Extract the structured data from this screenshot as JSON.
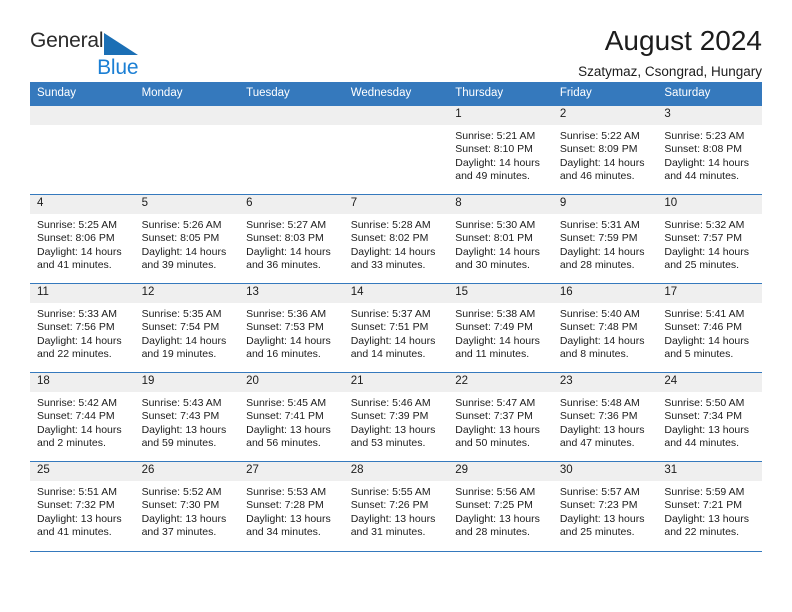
{
  "brand": {
    "name_top": "General",
    "name_bottom": "Blue",
    "triangle_icon": "blue-triangle-icon",
    "color_top": "#2b2b2b",
    "color_bottom": "#1b7fd4"
  },
  "header": {
    "title": "August 2024",
    "subtitle": "Szatymaz, Csongrad, Hungary"
  },
  "theme": {
    "header_blue": "#3579bd",
    "daynum_band": "#efefef",
    "text": "#1c1c1c"
  },
  "weekdays": [
    "Sunday",
    "Monday",
    "Tuesday",
    "Wednesday",
    "Thursday",
    "Friday",
    "Saturday"
  ],
  "weeks": [
    [
      {
        "day": "",
        "sunrise": "",
        "sunset": "",
        "daylight_line1": "",
        "daylight_line2": "",
        "empty": true
      },
      {
        "day": "",
        "sunrise": "",
        "sunset": "",
        "daylight_line1": "",
        "daylight_line2": "",
        "empty": true
      },
      {
        "day": "",
        "sunrise": "",
        "sunset": "",
        "daylight_line1": "",
        "daylight_line2": "",
        "empty": true
      },
      {
        "day": "",
        "sunrise": "",
        "sunset": "",
        "daylight_line1": "",
        "daylight_line2": "",
        "empty": true
      },
      {
        "day": "1",
        "sunrise": "Sunrise: 5:21 AM",
        "sunset": "Sunset: 8:10 PM",
        "daylight_line1": "Daylight: 14 hours",
        "daylight_line2": "and 49 minutes.",
        "empty": false
      },
      {
        "day": "2",
        "sunrise": "Sunrise: 5:22 AM",
        "sunset": "Sunset: 8:09 PM",
        "daylight_line1": "Daylight: 14 hours",
        "daylight_line2": "and 46 minutes.",
        "empty": false
      },
      {
        "day": "3",
        "sunrise": "Sunrise: 5:23 AM",
        "sunset": "Sunset: 8:08 PM",
        "daylight_line1": "Daylight: 14 hours",
        "daylight_line2": "and 44 minutes.",
        "empty": false
      }
    ],
    [
      {
        "day": "4",
        "sunrise": "Sunrise: 5:25 AM",
        "sunset": "Sunset: 8:06 PM",
        "daylight_line1": "Daylight: 14 hours",
        "daylight_line2": "and 41 minutes.",
        "empty": false
      },
      {
        "day": "5",
        "sunrise": "Sunrise: 5:26 AM",
        "sunset": "Sunset: 8:05 PM",
        "daylight_line1": "Daylight: 14 hours",
        "daylight_line2": "and 39 minutes.",
        "empty": false
      },
      {
        "day": "6",
        "sunrise": "Sunrise: 5:27 AM",
        "sunset": "Sunset: 8:03 PM",
        "daylight_line1": "Daylight: 14 hours",
        "daylight_line2": "and 36 minutes.",
        "empty": false
      },
      {
        "day": "7",
        "sunrise": "Sunrise: 5:28 AM",
        "sunset": "Sunset: 8:02 PM",
        "daylight_line1": "Daylight: 14 hours",
        "daylight_line2": "and 33 minutes.",
        "empty": false
      },
      {
        "day": "8",
        "sunrise": "Sunrise: 5:30 AM",
        "sunset": "Sunset: 8:01 PM",
        "daylight_line1": "Daylight: 14 hours",
        "daylight_line2": "and 30 minutes.",
        "empty": false
      },
      {
        "day": "9",
        "sunrise": "Sunrise: 5:31 AM",
        "sunset": "Sunset: 7:59 PM",
        "daylight_line1": "Daylight: 14 hours",
        "daylight_line2": "and 28 minutes.",
        "empty": false
      },
      {
        "day": "10",
        "sunrise": "Sunrise: 5:32 AM",
        "sunset": "Sunset: 7:57 PM",
        "daylight_line1": "Daylight: 14 hours",
        "daylight_line2": "and 25 minutes.",
        "empty": false
      }
    ],
    [
      {
        "day": "11",
        "sunrise": "Sunrise: 5:33 AM",
        "sunset": "Sunset: 7:56 PM",
        "daylight_line1": "Daylight: 14 hours",
        "daylight_line2": "and 22 minutes.",
        "empty": false
      },
      {
        "day": "12",
        "sunrise": "Sunrise: 5:35 AM",
        "sunset": "Sunset: 7:54 PM",
        "daylight_line1": "Daylight: 14 hours",
        "daylight_line2": "and 19 minutes.",
        "empty": false
      },
      {
        "day": "13",
        "sunrise": "Sunrise: 5:36 AM",
        "sunset": "Sunset: 7:53 PM",
        "daylight_line1": "Daylight: 14 hours",
        "daylight_line2": "and 16 minutes.",
        "empty": false
      },
      {
        "day": "14",
        "sunrise": "Sunrise: 5:37 AM",
        "sunset": "Sunset: 7:51 PM",
        "daylight_line1": "Daylight: 14 hours",
        "daylight_line2": "and 14 minutes.",
        "empty": false
      },
      {
        "day": "15",
        "sunrise": "Sunrise: 5:38 AM",
        "sunset": "Sunset: 7:49 PM",
        "daylight_line1": "Daylight: 14 hours",
        "daylight_line2": "and 11 minutes.",
        "empty": false
      },
      {
        "day": "16",
        "sunrise": "Sunrise: 5:40 AM",
        "sunset": "Sunset: 7:48 PM",
        "daylight_line1": "Daylight: 14 hours",
        "daylight_line2": "and 8 minutes.",
        "empty": false
      },
      {
        "day": "17",
        "sunrise": "Sunrise: 5:41 AM",
        "sunset": "Sunset: 7:46 PM",
        "daylight_line1": "Daylight: 14 hours",
        "daylight_line2": "and 5 minutes.",
        "empty": false
      }
    ],
    [
      {
        "day": "18",
        "sunrise": "Sunrise: 5:42 AM",
        "sunset": "Sunset: 7:44 PM",
        "daylight_line1": "Daylight: 14 hours",
        "daylight_line2": "and 2 minutes.",
        "empty": false
      },
      {
        "day": "19",
        "sunrise": "Sunrise: 5:43 AM",
        "sunset": "Sunset: 7:43 PM",
        "daylight_line1": "Daylight: 13 hours",
        "daylight_line2": "and 59 minutes.",
        "empty": false
      },
      {
        "day": "20",
        "sunrise": "Sunrise: 5:45 AM",
        "sunset": "Sunset: 7:41 PM",
        "daylight_line1": "Daylight: 13 hours",
        "daylight_line2": "and 56 minutes.",
        "empty": false
      },
      {
        "day": "21",
        "sunrise": "Sunrise: 5:46 AM",
        "sunset": "Sunset: 7:39 PM",
        "daylight_line1": "Daylight: 13 hours",
        "daylight_line2": "and 53 minutes.",
        "empty": false
      },
      {
        "day": "22",
        "sunrise": "Sunrise: 5:47 AM",
        "sunset": "Sunset: 7:37 PM",
        "daylight_line1": "Daylight: 13 hours",
        "daylight_line2": "and 50 minutes.",
        "empty": false
      },
      {
        "day": "23",
        "sunrise": "Sunrise: 5:48 AM",
        "sunset": "Sunset: 7:36 PM",
        "daylight_line1": "Daylight: 13 hours",
        "daylight_line2": "and 47 minutes.",
        "empty": false
      },
      {
        "day": "24",
        "sunrise": "Sunrise: 5:50 AM",
        "sunset": "Sunset: 7:34 PM",
        "daylight_line1": "Daylight: 13 hours",
        "daylight_line2": "and 44 minutes.",
        "empty": false
      }
    ],
    [
      {
        "day": "25",
        "sunrise": "Sunrise: 5:51 AM",
        "sunset": "Sunset: 7:32 PM",
        "daylight_line1": "Daylight: 13 hours",
        "daylight_line2": "and 41 minutes.",
        "empty": false
      },
      {
        "day": "26",
        "sunrise": "Sunrise: 5:52 AM",
        "sunset": "Sunset: 7:30 PM",
        "daylight_line1": "Daylight: 13 hours",
        "daylight_line2": "and 37 minutes.",
        "empty": false
      },
      {
        "day": "27",
        "sunrise": "Sunrise: 5:53 AM",
        "sunset": "Sunset: 7:28 PM",
        "daylight_line1": "Daylight: 13 hours",
        "daylight_line2": "and 34 minutes.",
        "empty": false
      },
      {
        "day": "28",
        "sunrise": "Sunrise: 5:55 AM",
        "sunset": "Sunset: 7:26 PM",
        "daylight_line1": "Daylight: 13 hours",
        "daylight_line2": "and 31 minutes.",
        "empty": false
      },
      {
        "day": "29",
        "sunrise": "Sunrise: 5:56 AM",
        "sunset": "Sunset: 7:25 PM",
        "daylight_line1": "Daylight: 13 hours",
        "daylight_line2": "and 28 minutes.",
        "empty": false
      },
      {
        "day": "30",
        "sunrise": "Sunrise: 5:57 AM",
        "sunset": "Sunset: 7:23 PM",
        "daylight_line1": "Daylight: 13 hours",
        "daylight_line2": "and 25 minutes.",
        "empty": false
      },
      {
        "day": "31",
        "sunrise": "Sunrise: 5:59 AM",
        "sunset": "Sunset: 7:21 PM",
        "daylight_line1": "Daylight: 13 hours",
        "daylight_line2": "and 22 minutes.",
        "empty": false
      }
    ]
  ]
}
